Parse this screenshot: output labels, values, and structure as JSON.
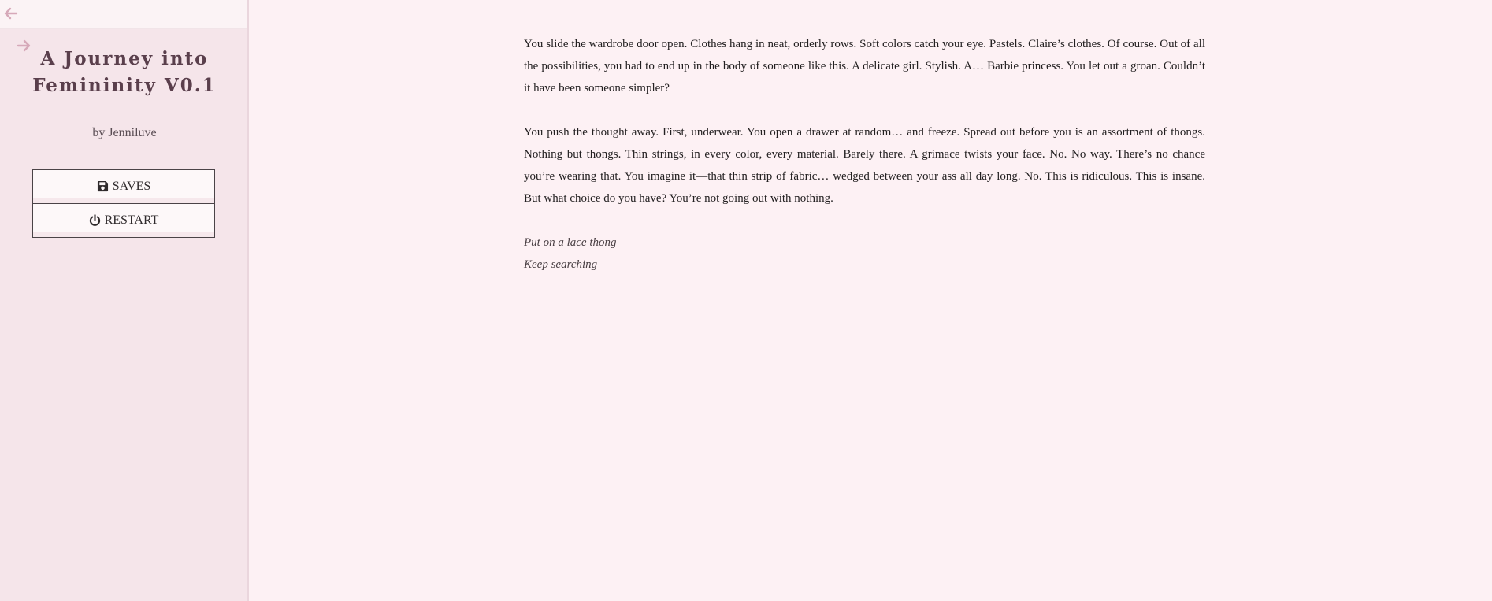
{
  "sidebar": {
    "title": "A Journey into Femininity V0.1",
    "author": "by Jenniluve",
    "menu": {
      "saves_label": "SAVES",
      "restart_label": "RESTART"
    },
    "icons": {
      "back": "arrow-left-icon",
      "forward": "arrow-right-icon",
      "saves": "floppy-disk-icon",
      "restart": "power-icon"
    },
    "colors": {
      "background": "#f5e5ea",
      "nav_arrow": "#d6a9b9",
      "title": "#5a3f4c"
    }
  },
  "passage": {
    "paragraphs": [
      "You slide the wardrobe door open. Clothes hang in neat, orderly rows. Soft colors catch your eye. Pastels. Claire’s clothes. Of course. Out of all the possibilities, you had to end up in the body of someone like this. A delicate girl. Stylish. A… Barbie princess. You let out a groan. Couldn’t it have been someone simpler?",
      "You push the thought away. First, underwear. You open a drawer at random… and freeze. Spread out before you is an assortment of thongs. Nothing but thongs. Thin strings, in every color, every material. Barely there. A grimace twists your face. No. No way. There’s no chance you’re wearing that. You imagine it—that thin strip of fabric… wedged between your ass all day long. No. This is ridiculous. This is insane. But what choice do you have? You’re not going out with nothing."
    ],
    "choices": [
      "Put on a lace thong",
      "Keep searching"
    ]
  }
}
